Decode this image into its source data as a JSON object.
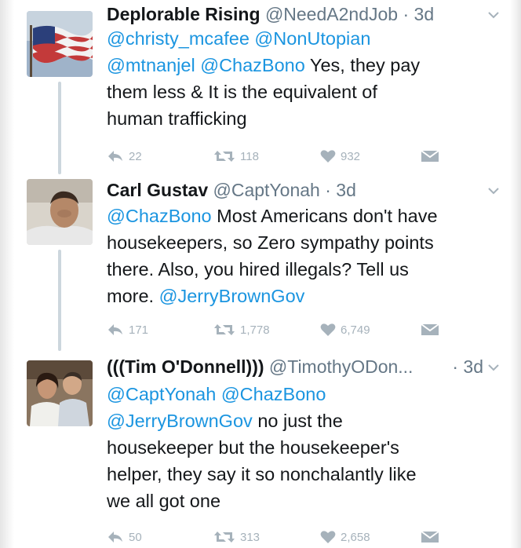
{
  "tweets": [
    {
      "name": "Deplorable Rising",
      "handle": "@NeedA2ndJob",
      "dot": "·",
      "time": "3d",
      "avatar_icon": "american-flag-icon",
      "lines": [
        [
          {
            "t": "@christy_mcafee",
            "m": true
          },
          {
            "t": " ",
            "m": false
          },
          {
            "t": "@NonUtopian",
            "m": true
          }
        ],
        [
          {
            "t": "@mtnanjel",
            "m": true
          },
          {
            "t": " ",
            "m": false
          },
          {
            "t": "@ChazBono",
            "m": true
          },
          {
            "t": " Yes, they pay",
            "m": false
          }
        ],
        [
          {
            "t": "them less & It is the equivalent of",
            "m": false
          }
        ],
        [
          {
            "t": "human trafficking",
            "m": false
          }
        ]
      ],
      "replies": "22",
      "retweets": "118",
      "likes": "932"
    },
    {
      "name": "Carl Gustav",
      "handle": "@CaptYonah",
      "dot": "·",
      "time": "3d",
      "avatar_icon": "profile-photo-man",
      "lines": [
        [
          {
            "t": "@ChazBono",
            "m": true
          },
          {
            "t": " Most Americans don't have",
            "m": false
          }
        ],
        [
          {
            "t": "housekeepers, so Zero sympathy points",
            "m": false
          }
        ],
        [
          {
            "t": "there. Also, you hired illegals? Tell us",
            "m": false
          }
        ],
        [
          {
            "t": "more. ",
            "m": false
          },
          {
            "t": "@JerryBrownGov",
            "m": true
          }
        ]
      ],
      "replies": "171",
      "retweets": "1,778",
      "likes": "6,749"
    },
    {
      "name": "(((Tim O'Donnell)))",
      "handle": "@TimothyODon...",
      "dot": "·",
      "time": "3d",
      "avatar_icon": "profile-photo-couple",
      "lines": [
        [
          {
            "t": "@CaptYonah",
            "m": true
          },
          {
            "t": " ",
            "m": false
          },
          {
            "t": "@ChazBono",
            "m": true
          }
        ],
        [
          {
            "t": "@JerryBrownGov",
            "m": true
          },
          {
            "t": " no just the",
            "m": false
          }
        ],
        [
          {
            "t": "housekeeper but the housekeeper's",
            "m": false
          }
        ],
        [
          {
            "t": "helper, they say it so nonchalantly like",
            "m": false
          }
        ],
        [
          {
            "t": "we all got one",
            "m": false
          }
        ]
      ],
      "replies": "50",
      "retweets": "313",
      "likes": "2,658"
    }
  ],
  "colors": {
    "mention": "#1b95e0",
    "action_gray": "#a6b2bb",
    "meta_gray": "#657786"
  }
}
